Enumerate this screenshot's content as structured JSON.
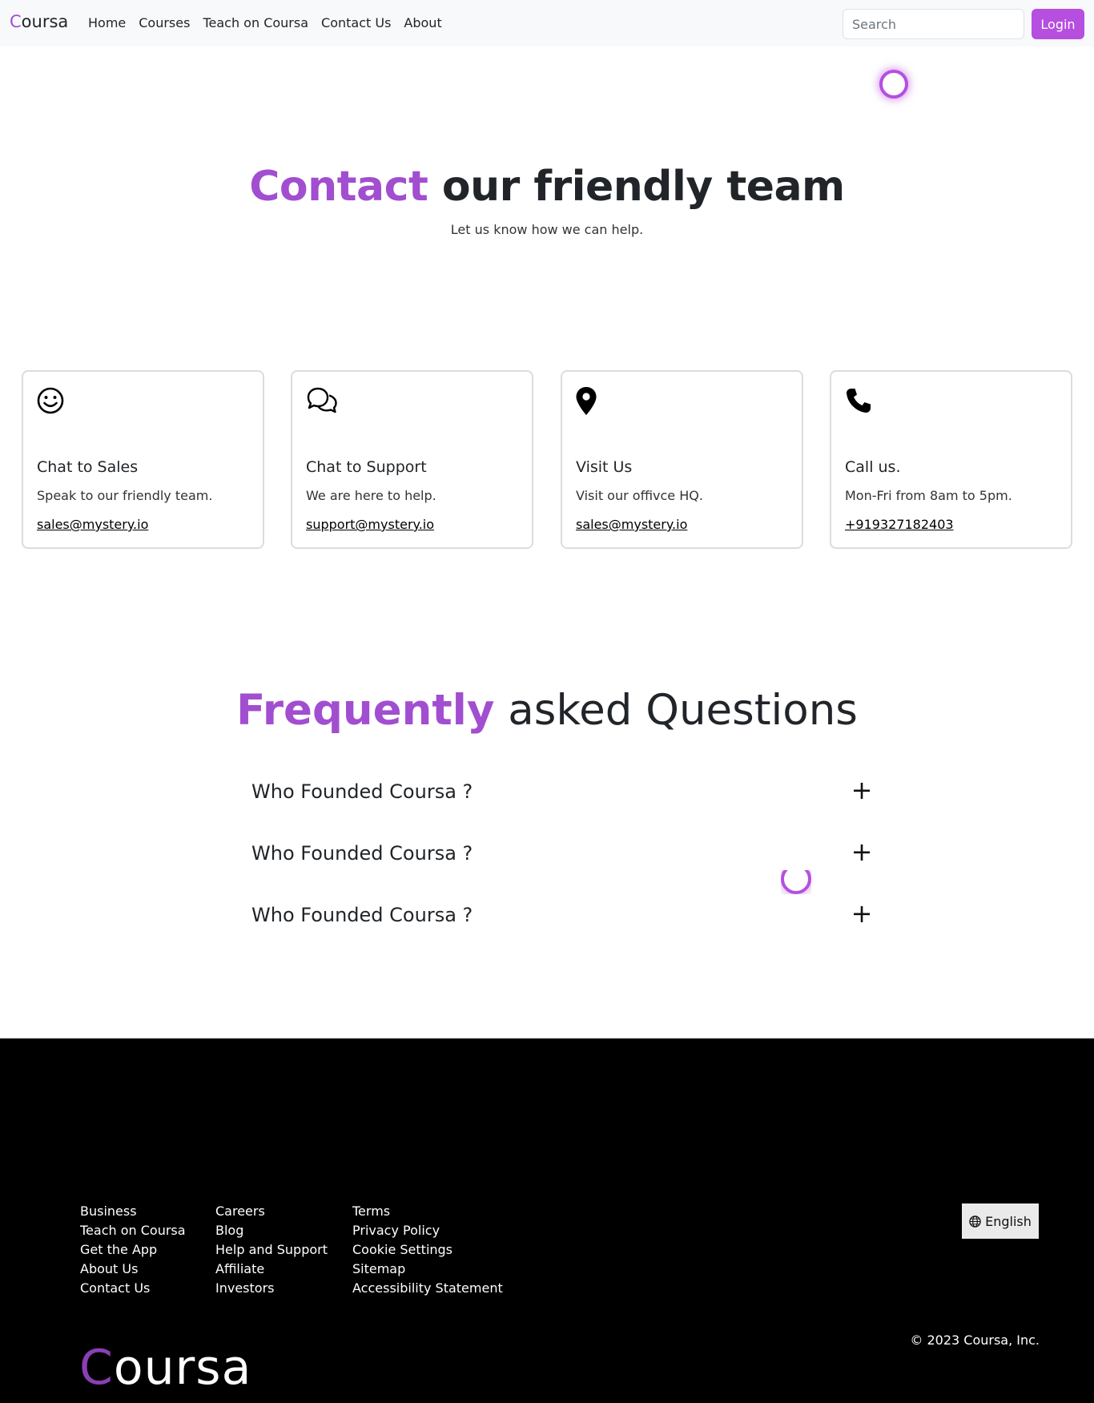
{
  "navbar": {
    "brand_first": "C",
    "brand_rest": "oursa",
    "links": [
      "Home",
      "Courses",
      "Teach on Coursa",
      "Contact Us",
      "About"
    ],
    "search_placeholder": "Search",
    "login_label": "Login"
  },
  "hero": {
    "title_accent": "Contact",
    "title_rest": " our friendly team",
    "subtitle": "Let us know how we can help."
  },
  "cards": [
    {
      "icon": "smiley-icon",
      "title": "Chat to Sales",
      "desc": "Speak to our friendly team.",
      "link": "sales@mystery.io"
    },
    {
      "icon": "chat-bubbles-icon",
      "title": "Chat to Support",
      "desc": "We are here to help.",
      "link": "support@mystery.io"
    },
    {
      "icon": "location-pin-icon",
      "title": "Visit Us",
      "desc": "Visit our offivce HQ.",
      "link": "sales@mystery.io"
    },
    {
      "icon": "phone-icon",
      "title": "Call us.",
      "desc": "Mon-Fri from 8am to 5pm.",
      "link": "+919327182403"
    }
  ],
  "faq": {
    "title_accent": "Frequently",
    "title_rest": " asked Questions",
    "items": [
      {
        "question": "Who Founded Coursa ?",
        "toggle": "+"
      },
      {
        "question": "Who Founded Coursa ?",
        "toggle": "+"
      },
      {
        "question": "Who Founded Coursa ?",
        "toggle": "+"
      }
    ]
  },
  "footer": {
    "col1": [
      "Business",
      "Teach on Coursa",
      "Get the App",
      "About Us",
      "Contact Us"
    ],
    "col2": [
      "Careers",
      "Blog",
      "Help and Support",
      "Affiliate",
      "Investors"
    ],
    "col3": [
      "Terms",
      "Privacy Policy",
      "Cookie Settings",
      "Sitemap",
      "Accessibility Statement"
    ],
    "language": "English",
    "copyright": "© 2023 Coursa, Inc.",
    "brand_first": "C",
    "brand_rest": "oursa"
  },
  "colors": {
    "accent": "#a24ed0",
    "button": "#b64ee0",
    "footer_bg": "#000000"
  }
}
